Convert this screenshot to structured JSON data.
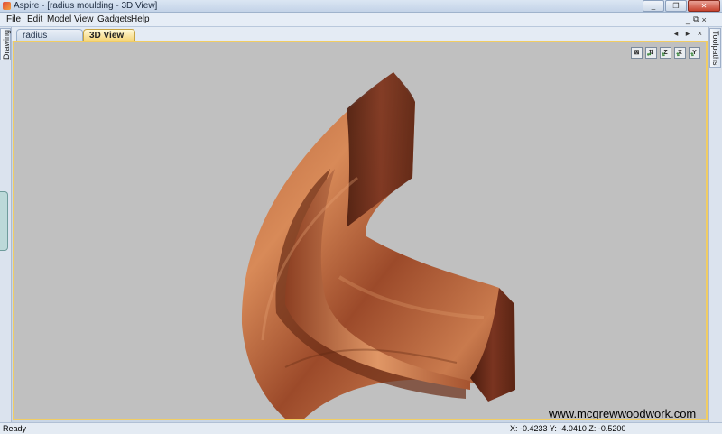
{
  "window": {
    "title": "Aspire - [radius moulding - 3D View]",
    "minimize": "_",
    "restore": "❐",
    "close": "✕"
  },
  "menu": [
    "File",
    "Edit",
    "Model",
    "View",
    "Gadgets",
    "Help"
  ],
  "mdi_controls": {
    "minimize": "_",
    "restore": "⧉",
    "close": "×"
  },
  "side_tabs": {
    "left": "Drawing",
    "right": "Toolpaths"
  },
  "doc_tabs": {
    "tabs": [
      "radius moulding",
      "3D View"
    ],
    "active_index": 1,
    "nav": "◂ ▸ ×"
  },
  "view_icons": [
    {
      "name": "fit-view",
      "glyph": "⊠",
      "sub": ""
    },
    {
      "name": "iso-view",
      "glyph": "⇅",
      "sub": "⇄"
    },
    {
      "name": "view-z",
      "glyph": "Z",
      "sub": "⇅"
    },
    {
      "name": "view-x",
      "glyph": "X",
      "sub": "⇅"
    },
    {
      "name": "view-y",
      "glyph": "Y",
      "sub": "⇅"
    }
  ],
  "watermark": "www.mcgrewwoodwork.com",
  "status": {
    "left": "Ready",
    "coords": "X: -0.4233 Y: -4.0410 Z: -0.5200"
  },
  "colors": {
    "viewport_bg": "#c0c0c0",
    "active_tab": "#f6d67a",
    "wood_light": "#c97a4d",
    "wood_dark": "#5a2413"
  }
}
